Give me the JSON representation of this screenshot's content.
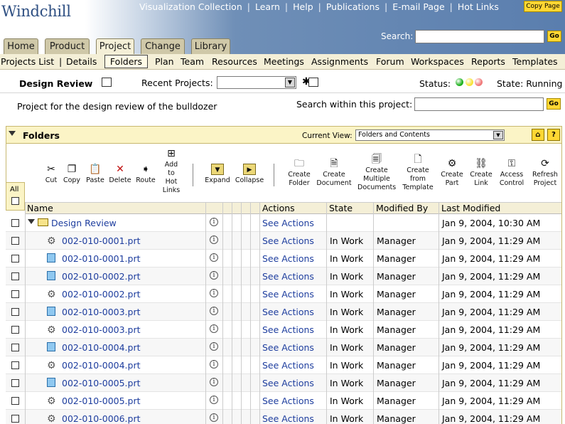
{
  "app": {
    "brand": "Windchill",
    "copy_page": "Copy Page"
  },
  "topnav": [
    "Visualization Collection",
    "Learn",
    "Help",
    "Publications",
    "E-mail Page",
    "Hot Links"
  ],
  "search": {
    "label": "Search:",
    "value": "",
    "go": "Go"
  },
  "tabs": [
    {
      "label": "Home",
      "active": false
    },
    {
      "label": "Product",
      "active": false
    },
    {
      "label": "Project",
      "active": true
    },
    {
      "label": "Change",
      "active": false
    },
    {
      "label": "Library",
      "active": false
    }
  ],
  "subnav": {
    "projects_list": "Projects List",
    "details": "Details",
    "folders": "Folders",
    "items": [
      "Plan",
      "Team",
      "Resources",
      "Meetings",
      "Assignments",
      "Forum",
      "Workspaces",
      "Reports",
      "Templates"
    ]
  },
  "project": {
    "title": "Design Review",
    "recent_label": "Recent Projects:",
    "recent_value": "",
    "status_label": "Status:",
    "status_colors": [
      "#1fb21f",
      "#f7e33b",
      "#f07a7a"
    ],
    "state_label": "State: Running",
    "description": "Project for the design review of the bulldozer",
    "within_label": "Search within this project:",
    "within_value": "",
    "go": "Go"
  },
  "panel": {
    "title": "Folders",
    "current_view_label": "Current View:",
    "current_view_value": "Folders and Contents",
    "help": "?"
  },
  "toolbar": {
    "all": "All",
    "cut": "Cut",
    "copy": "Copy",
    "paste": "Paste",
    "delete": "Delete",
    "route": "Route",
    "hot_links": [
      "Add",
      "to",
      "Hot",
      "Links"
    ],
    "expand": "Expand",
    "collapse": "Collapse",
    "create_folder": [
      "Create",
      "Folder"
    ],
    "create_document": [
      "Create",
      "Document"
    ],
    "create_multiple": [
      "Create",
      "Multiple",
      "Documents"
    ],
    "create_template": [
      "Create",
      "from",
      "Template"
    ],
    "create_part": [
      "Create",
      "Part"
    ],
    "create_link": [
      "Create",
      "Link"
    ],
    "access_control": [
      "Access",
      "Control"
    ],
    "refresh_project": [
      "Refresh",
      "Project"
    ]
  },
  "columns": {
    "name": "Name",
    "actions": "Actions",
    "state": "State",
    "modified_by": "Modified By",
    "last_modified": "Last Modified"
  },
  "folder_row": {
    "name": "Design Review",
    "actions": "See Actions",
    "state": "",
    "modified_by": "",
    "last_modified": "Jan 9, 2004, 10:30 AM"
  },
  "rows": [
    {
      "name": "002-010-0001.prt",
      "kind": "part",
      "actions": "See Actions",
      "state": "In Work",
      "modified_by": "Manager",
      "last_modified": "Jan 9, 2004, 11:29 AM"
    },
    {
      "name": "002-010-0001.prt",
      "kind": "doc",
      "actions": "See Actions",
      "state": "In Work",
      "modified_by": "Manager",
      "last_modified": "Jan 9, 2004, 11:29 AM"
    },
    {
      "name": "002-010-0002.prt",
      "kind": "doc",
      "actions": "See Actions",
      "state": "In Work",
      "modified_by": "Manager",
      "last_modified": "Jan 9, 2004, 11:29 AM"
    },
    {
      "name": "002-010-0002.prt",
      "kind": "part",
      "actions": "See Actions",
      "state": "In Work",
      "modified_by": "Manager",
      "last_modified": "Jan 9, 2004, 11:29 AM"
    },
    {
      "name": "002-010-0003.prt",
      "kind": "doc",
      "actions": "See Actions",
      "state": "In Work",
      "modified_by": "Manager",
      "last_modified": "Jan 9, 2004, 11:29 AM"
    },
    {
      "name": "002-010-0003.prt",
      "kind": "part",
      "actions": "See Actions",
      "state": "In Work",
      "modified_by": "Manager",
      "last_modified": "Jan 9, 2004, 11:29 AM"
    },
    {
      "name": "002-010-0004.prt",
      "kind": "doc",
      "actions": "See Actions",
      "state": "In Work",
      "modified_by": "Manager",
      "last_modified": "Jan 9, 2004, 11:29 AM"
    },
    {
      "name": "002-010-0004.prt",
      "kind": "part",
      "actions": "See Actions",
      "state": "In Work",
      "modified_by": "Manager",
      "last_modified": "Jan 9, 2004, 11:29 AM"
    },
    {
      "name": "002-010-0005.prt",
      "kind": "doc",
      "actions": "See Actions",
      "state": "In Work",
      "modified_by": "Manager",
      "last_modified": "Jan 9, 2004, 11:29 AM"
    },
    {
      "name": "002-010-0005.prt",
      "kind": "part",
      "actions": "See Actions",
      "state": "In Work",
      "modified_by": "Manager",
      "last_modified": "Jan 9, 2004, 11:29 AM"
    },
    {
      "name": "002-010-0006.prt",
      "kind": "part",
      "actions": "See Actions",
      "state": "In Work",
      "modified_by": "Manager",
      "last_modified": "Jan 9, 2004, 11:29 AM"
    }
  ]
}
